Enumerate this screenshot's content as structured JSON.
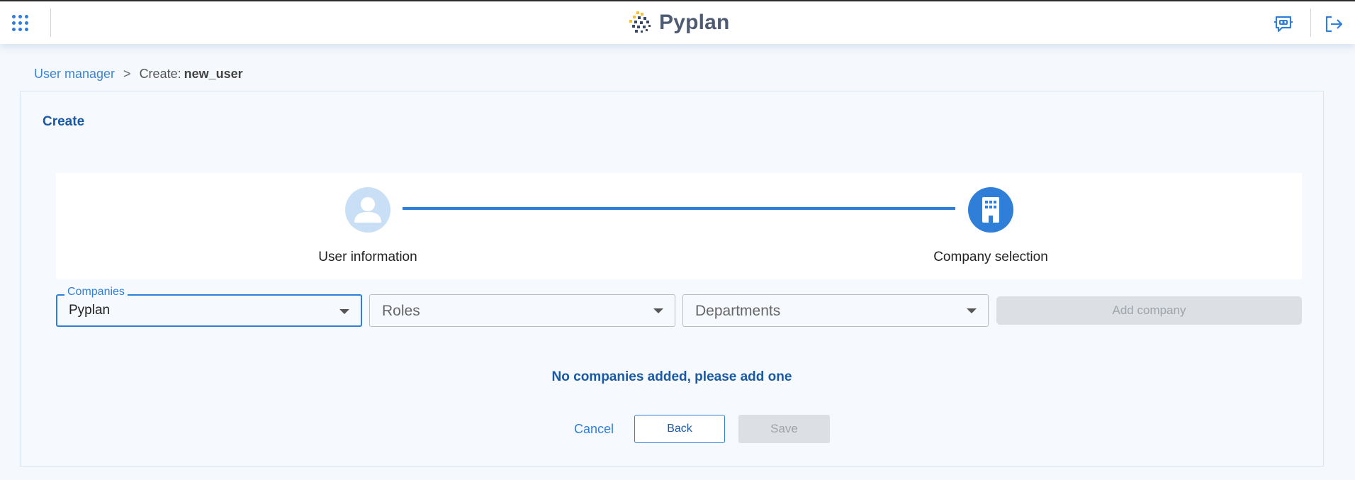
{
  "header": {
    "apps_icon": "apps-grid-icon",
    "logo_text": "Pyplan",
    "chat_icon": "chatbot-icon",
    "logout_icon": "logout-icon",
    "accent_color": "#2f7fd8"
  },
  "breadcrumb": {
    "parent": "User manager",
    "separator": ">",
    "current_prefix": "Create:",
    "current_name": "new_user"
  },
  "panel": {
    "title": "Create"
  },
  "stepper": {
    "steps": [
      {
        "label": "User information",
        "icon": "user-icon",
        "state": "completed"
      },
      {
        "label": "Company selection",
        "icon": "building-icon",
        "state": "active"
      }
    ]
  },
  "form": {
    "companies": {
      "label": "Companies",
      "value": "Pyplan"
    },
    "roles": {
      "placeholder": "Roles"
    },
    "departments": {
      "placeholder": "Departments"
    },
    "add_company_label": "Add company"
  },
  "empty_message": "No companies added, please add one",
  "actions": {
    "cancel": "Cancel",
    "back": "Back",
    "save": "Save"
  }
}
